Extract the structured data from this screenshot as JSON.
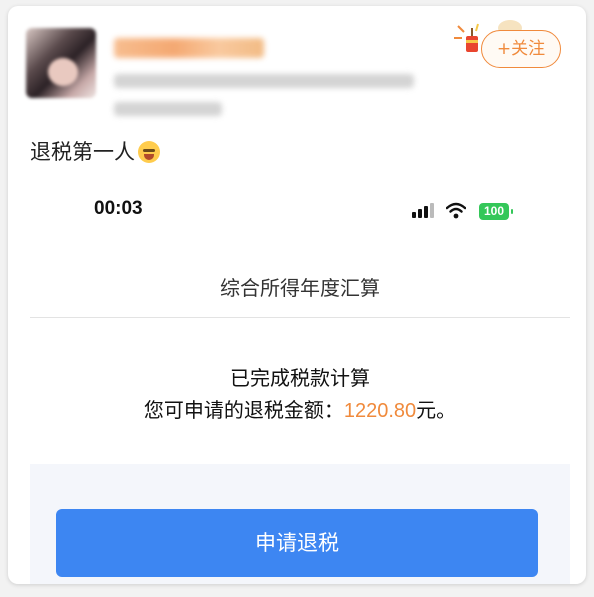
{
  "post": {
    "author_name": "",
    "follow_label": "+关注",
    "text": "退税第一人",
    "emoji_icon": "flushed-face-emoji"
  },
  "screenshot": {
    "status": {
      "time": "00:03",
      "battery": "100"
    },
    "page_title": "综合所得年度汇算",
    "done_text": "已完成税款计算",
    "refund_prefix": "您可申请的退税金额：",
    "refund_amount": "1220.80",
    "refund_suffix": "元。",
    "apply_button": "申请退税"
  },
  "colors": {
    "accent_orange": "#f08a3c",
    "button_blue": "#3d86f2",
    "battery_green": "#34c759"
  }
}
